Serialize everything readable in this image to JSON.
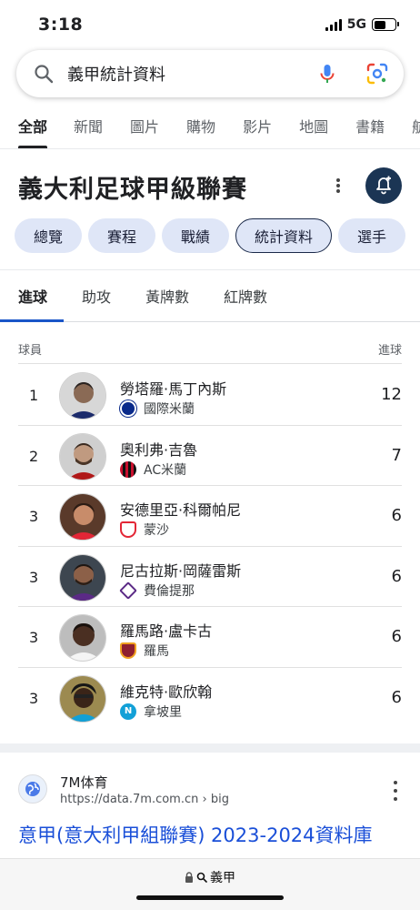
{
  "status_bar": {
    "time": "3:18",
    "network": "5G"
  },
  "search": {
    "query": "義甲統計資料"
  },
  "tabs": [
    {
      "label": "全部",
      "active": true
    },
    {
      "label": "新聞"
    },
    {
      "label": "圖片"
    },
    {
      "label": "購物"
    },
    {
      "label": "影片"
    },
    {
      "label": "地圖"
    },
    {
      "label": "書籍"
    },
    {
      "label": "航"
    }
  ],
  "entity": {
    "title": "義大利足球甲級聯賽"
  },
  "chips": [
    {
      "label": "總覽"
    },
    {
      "label": "賽程"
    },
    {
      "label": "戰績"
    },
    {
      "label": "統計資料",
      "active": true
    },
    {
      "label": "選手"
    }
  ],
  "subtabs": [
    {
      "label": "進球",
      "active": true
    },
    {
      "label": "助攻"
    },
    {
      "label": "黃牌數"
    },
    {
      "label": "紅牌數"
    }
  ],
  "table": {
    "headers": {
      "player": "球員",
      "goals": "進球"
    },
    "rows": [
      {
        "rank": "1",
        "name": "勞塔羅·馬丁內斯",
        "team": "國際米蘭",
        "goals": "12",
        "team_color": "#0a2a8a"
      },
      {
        "rank": "2",
        "name": "奧利弗·吉魯",
        "team": "AC米蘭",
        "goals": "7",
        "team_color": "#c8102e"
      },
      {
        "rank": "3",
        "name": "安德里亞·科爾帕尼",
        "team": "蒙沙",
        "goals": "6",
        "team_color": "#e32636"
      },
      {
        "rank": "3",
        "name": "尼古拉斯·岡薩雷斯",
        "team": "費倫提那",
        "goals": "6",
        "team_color": "#5b2a86"
      },
      {
        "rank": "3",
        "name": "羅馬路·盧卡古",
        "team": "羅馬",
        "goals": "6",
        "team_color": "#8e1f2f"
      },
      {
        "rank": "3",
        "name": "維克特·歐欣翰",
        "team": "拿坡里",
        "goals": "6",
        "team_color": "#12a0d7"
      }
    ]
  },
  "result": {
    "site_name": "7M体育",
    "url": "https://data.7m.com.cn › big",
    "title": "意甲(意大利甲組聯賽) 2023-2024資料庫"
  },
  "bottom_bar": {
    "address": "義甲"
  },
  "colors": {
    "link": "#1a4fd8",
    "chip_bg": "#dfe6f7",
    "bell_bg": "#1b3554",
    "active_underline": "#1a56c8"
  }
}
